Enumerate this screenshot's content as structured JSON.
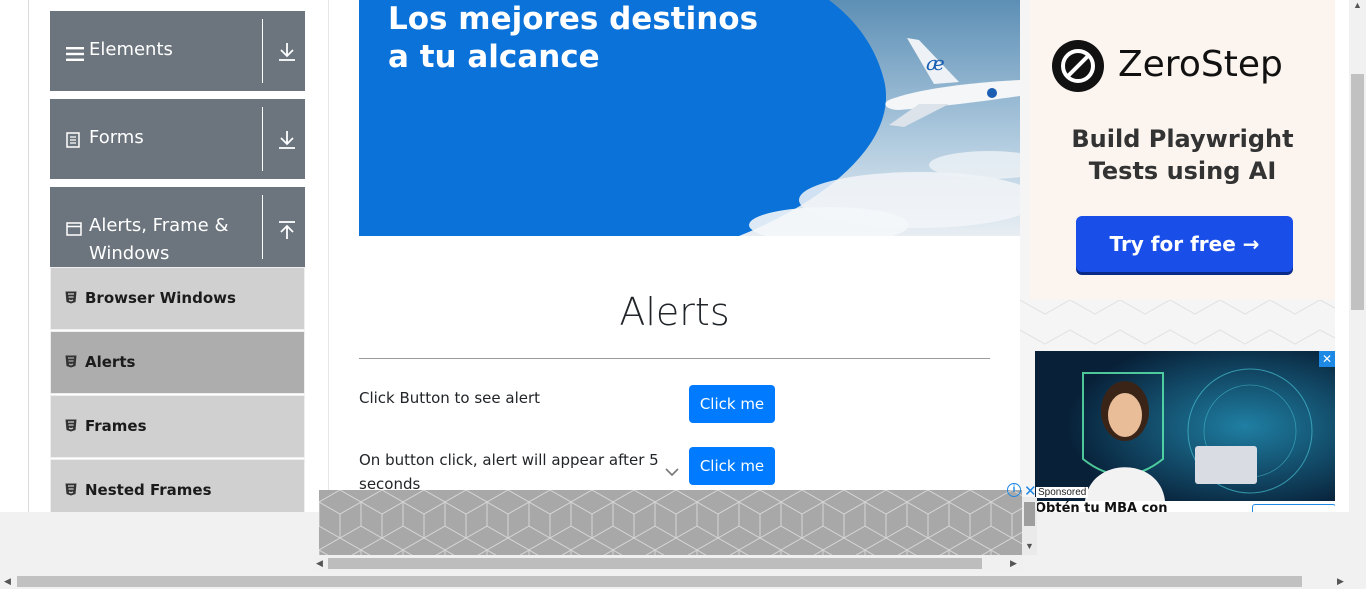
{
  "sidebar": {
    "groups": [
      {
        "label": "Elements",
        "icon": "hamburger-icon",
        "toggle": "download-arrow-icon"
      },
      {
        "label": "Forms",
        "icon": "document-icon",
        "toggle": "download-arrow-icon"
      },
      {
        "label_line1": "Alerts, Frame &",
        "label_line2": "Windows",
        "icon": "window-icon",
        "toggle": "upload-arrow-icon",
        "expanded": true
      }
    ],
    "items": [
      {
        "label": "Browser Windows",
        "active": false
      },
      {
        "label": "Alerts",
        "active": true
      },
      {
        "label": "Frames",
        "active": false
      },
      {
        "label": "Nested Frames",
        "active": false
      }
    ]
  },
  "banner": {
    "line1": "Los mejores destinos",
    "line2": "a tu alcance",
    "logo": "æ"
  },
  "main": {
    "title": "Alerts",
    "rows": [
      {
        "label": "Click Button to see alert",
        "button": "Click me"
      },
      {
        "label": "On button click, alert will appear after 5 seconds",
        "button": "Click me"
      }
    ]
  },
  "ads": {
    "zerostep": {
      "brand": "ZeroStep",
      "tagline_line1": "Build Playwright",
      "tagline_line2": "Tests using AI",
      "cta": "Try for free →"
    },
    "sponsored_label": "Sponsored",
    "sponsored_text": "Obtén tu MBA con",
    "info_glyph": "i",
    "close_glyph": "✕"
  },
  "colors": {
    "sidebar_header": "#6c757d",
    "menu_item": "#d0d0d0",
    "menu_item_active": "#adadad",
    "primary_button": "#007bff",
    "banner_blue": "#0a72d8",
    "zerostep_cta": "#1a4ee8"
  }
}
